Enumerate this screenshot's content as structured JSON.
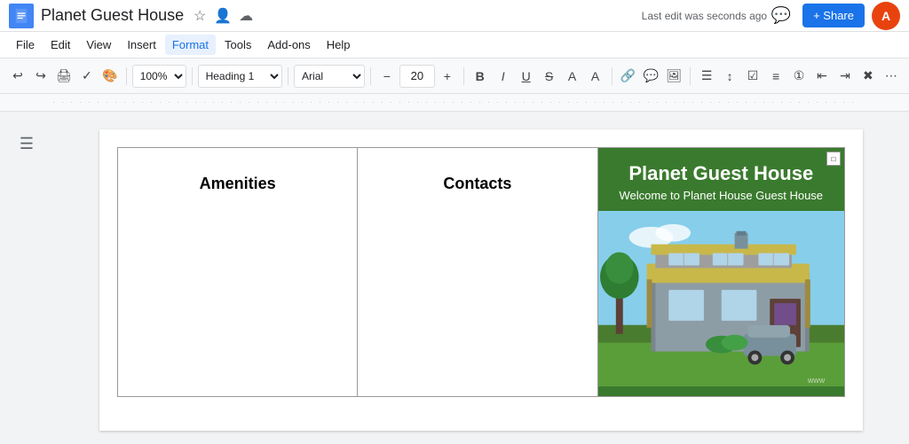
{
  "titleBar": {
    "docTitle": "Planet Guest House",
    "saveStatus": "Last edit was seconds ago",
    "shareLabel": "+ Share"
  },
  "menuBar": {
    "items": [
      "File",
      "Edit",
      "View",
      "Insert",
      "Format",
      "Tools",
      "Add-ons",
      "Help"
    ]
  },
  "toolbar": {
    "zoom": "100%",
    "headingStyle": "Heading 1",
    "font": "Arial",
    "fontSize": "20",
    "boldLabel": "B",
    "italicLabel": "I",
    "underlineLabel": "U"
  },
  "table": {
    "amenitiesHeader": "Amenities",
    "contactsHeader": "Contacts",
    "guestHouseTitle": "Planet Guest House",
    "guestHouseSubtitle": "Welcome to Planet House Guest House",
    "watermark": "www"
  }
}
